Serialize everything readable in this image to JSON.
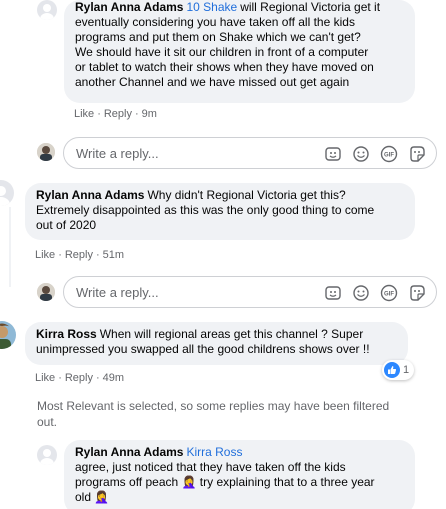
{
  "comments": [
    {
      "author": "Rylan Anna Adams",
      "mention": "10 Shake",
      "text_lines": [
        "will Regional Victoria get it",
        "eventually considering you have taken off all the kids",
        "programs and put them on Shake which we can't get?",
        "We should have it sit our children in front of a computer",
        "or tablet to watch their shows when they have moved on",
        "another Channel and we have missed out get again"
      ],
      "actions": [
        "Like",
        "Reply"
      ],
      "time": "9m"
    },
    {
      "author": "Rylan Anna Adams",
      "text_lines": [
        "Why didn't Regional Victoria get this?",
        "Extremely disappointed as this was the only good thing to come",
        "out of 2020"
      ],
      "actions": [
        "Like",
        "Reply"
      ],
      "time": "51m"
    },
    {
      "author": "Kirra Ross",
      "text_lines": [
        "When will regional areas get this channel ? Super",
        "unimpressed you swapped all the good childrens shows over !!"
      ],
      "actions": [
        "Like",
        "Reply"
      ],
      "time": "49m",
      "reaction": {
        "icon": "like-icon",
        "count": "1",
        "color": "#2d88ff"
      }
    },
    {
      "author": "Rylan Anna Adams",
      "mention": "Kirra Ross",
      "text_lines": [
        "agree, just noticed that they have taken off the kids",
        "programs off peach 🤦‍♀️ try explaining that to a three year",
        "old 🤦‍♀️"
      ]
    }
  ],
  "reply_box": {
    "placeholder": "Write a reply...",
    "tools": [
      "sticker-icon",
      "emoji-icon",
      "gif-icon",
      "camera-sticker-icon"
    ]
  },
  "filter_note": {
    "lines": [
      "Most Relevant is selected, so some replies may have been filtered",
      "out."
    ]
  },
  "colors": {
    "bubble": "#f0f2f5",
    "mention": "#216fdb",
    "muted": "#65676b",
    "like_blue": "#2d88ff"
  }
}
